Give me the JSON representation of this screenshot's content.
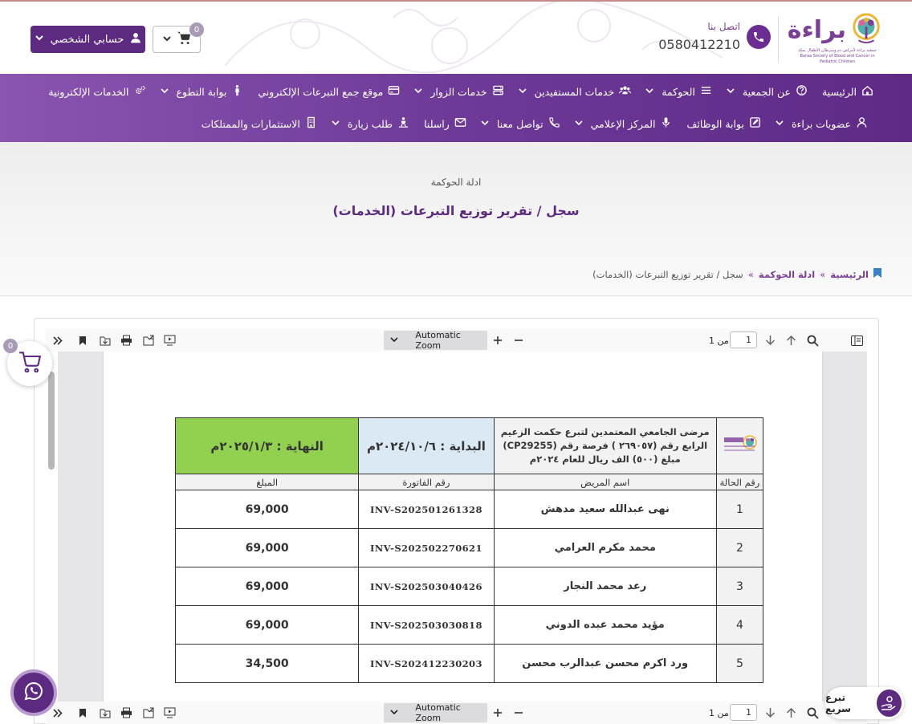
{
  "header": {
    "logo_name": "براءة",
    "logo_tagline": "جمعية براءة لأمراض دم وسرطان الأطفال بمكة",
    "logo_tagline_en": "Baraa Society of Blood and Cancer in Pediatric Children",
    "contact_label": "اتصل بنا",
    "contact_number": "0580412210",
    "account_label": "حسابي الشخصي",
    "cart_count": "0"
  },
  "nav": {
    "row1": [
      {
        "label": "الرئيسية",
        "icon": "home-icon",
        "dropdown": false
      },
      {
        "label": "عن الجمعية",
        "icon": "info-icon",
        "dropdown": true
      },
      {
        "label": "الحوكمة",
        "icon": "list-icon",
        "dropdown": true
      },
      {
        "label": "خدمات المستفيدين",
        "icon": "users-icon",
        "dropdown": true
      },
      {
        "label": "خدمات الزوار",
        "icon": "server-icon",
        "dropdown": true
      },
      {
        "label": "موقع جمع التبرعات الإلكتروني",
        "icon": "card-icon",
        "dropdown": false
      },
      {
        "label": "بوابة التطوع",
        "icon": "person-icon",
        "dropdown": true
      },
      {
        "label": "الخدمات الإلكترونية",
        "icon": "gears-icon",
        "dropdown": false
      }
    ],
    "row2": [
      {
        "label": "عضويات براءة",
        "icon": "user-icon",
        "dropdown": true
      },
      {
        "label": "بوابة الوظائف",
        "icon": "edit-icon",
        "dropdown": false
      },
      {
        "label": "المركز الإعلامي",
        "icon": "mic-icon",
        "dropdown": true
      },
      {
        "label": "تواصل معنا",
        "icon": "phone-icon",
        "dropdown": true
      },
      {
        "label": "راسلنا",
        "icon": "envelope-icon",
        "dropdown": false
      },
      {
        "label": "طلب زيارة",
        "icon": "visit-icon",
        "dropdown": true
      },
      {
        "label": "الاستثمارات والممتلكات",
        "icon": "building-icon",
        "dropdown": false
      }
    ]
  },
  "hero": {
    "kicker": "ادلة الحوكمة",
    "title": "سجل / تقرير توزيع التبرعات (الخدمات)"
  },
  "breadcrumb": {
    "home": "الرئيسية",
    "parent": "ادلة الحوكمة",
    "current": "سجل / تقرير توزيع التبرعات (الخدمات)",
    "separator": "»"
  },
  "viewer": {
    "zoom": "Automatic Zoom",
    "page_value": "1",
    "page_of": "من 1"
  },
  "document": {
    "header_desc_line1": "مرضى الجامعي المعتمدين لتبرع حكمت الزعيم",
    "header_desc_line2": "الرابع رقم (٢٦٩٠٥٧ ) فرصة رقم (CP29255)",
    "header_desc_line3": "مبلغ (٥٠٠) الف ريال للعام ٢٠٢٤م",
    "start_label": "البداية : ٢٠٢٤/١٠/٦م",
    "end_label": "النهاية : ٢٠٢٥/١/٣م",
    "columns": [
      "رقم الحالة",
      "اسم المريض",
      "رقم الفاتورة",
      "المبلغ"
    ],
    "rows": [
      {
        "no": "1",
        "name": "نهى عبدالله سعيد مدهش",
        "invoice": "INV-S202501261328",
        "amount": "69,000"
      },
      {
        "no": "2",
        "name": "محمد مكرم العرامي",
        "invoice": "INV-S202502270621",
        "amount": "69,000"
      },
      {
        "no": "3",
        "name": "رعد محمد النجار",
        "invoice": "INV-S202503040426",
        "amount": "69,000"
      },
      {
        "no": "4",
        "name": "مؤيد محمد عبده الدوني",
        "invoice": "INV-S202503030818",
        "amount": "69,000"
      },
      {
        "no": "5",
        "name": "ورد اكرم محسن عبدالرب محسن",
        "invoice": "INV-S202412230203",
        "amount": "34,500"
      }
    ]
  },
  "floating": {
    "cart_count": "0",
    "quick_donate": "تبرع سريع"
  },
  "colors": {
    "brand_purple": "#5d2a82",
    "nav_gradient_start": "#8a55b0",
    "end_green": "#92d050",
    "start_blue": "#dbe9f5"
  }
}
